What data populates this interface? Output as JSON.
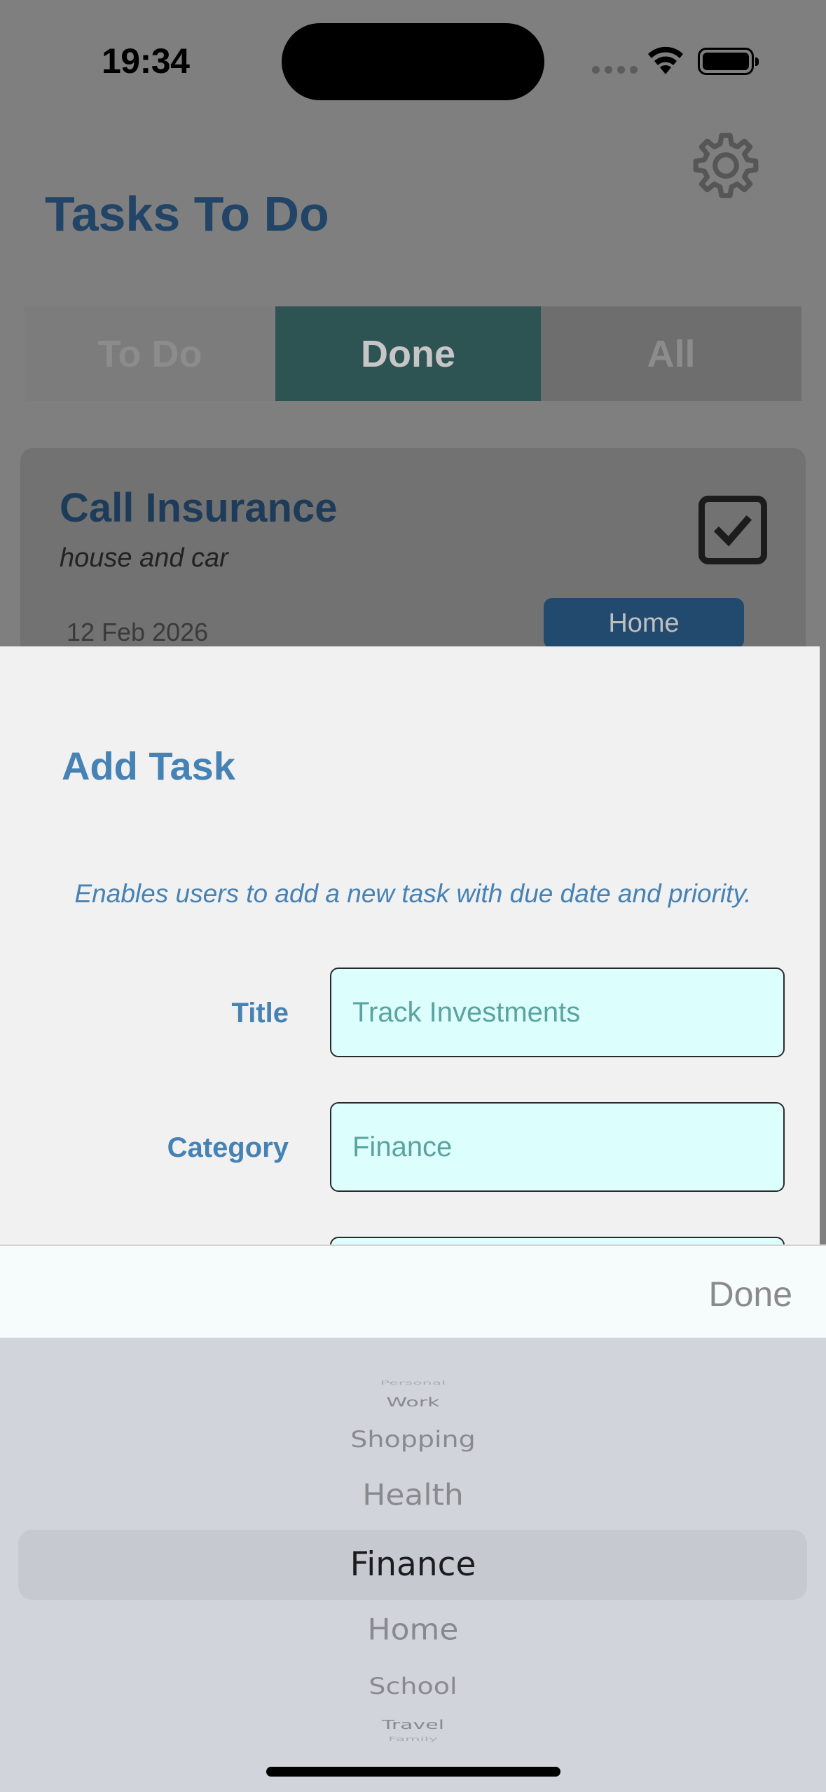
{
  "status_bar": {
    "time": "19:34"
  },
  "header": {
    "title": "Tasks To Do",
    "settings_icon": "gear-icon"
  },
  "segments": [
    {
      "label": "To Do",
      "selected": false
    },
    {
      "label": "Done",
      "selected": true
    },
    {
      "label": "All",
      "selected": false
    }
  ],
  "task_card": {
    "title": "Call Insurance",
    "subtitle": "house and car",
    "date": "12 Feb 2026",
    "category": "Home",
    "done": true
  },
  "sheet": {
    "title": "Add Task",
    "description": "Enables users to add a new task with due date and priority.",
    "fields": {
      "title_label": "Title",
      "title_value": "Track Investments",
      "category_label": "Category",
      "category_value": "Finance"
    }
  },
  "keyboard": {
    "done_label": "Done",
    "picker_options": [
      "Personal",
      "Work",
      "Shopping",
      "Health",
      "Finance",
      "Home",
      "School",
      "Travel",
      "Family"
    ],
    "selected": "Finance"
  },
  "colors": {
    "accent": "#4682b4",
    "segment_selected": "#2d5352",
    "input_bg": "#dcfffe",
    "badge": "#224a6e"
  }
}
